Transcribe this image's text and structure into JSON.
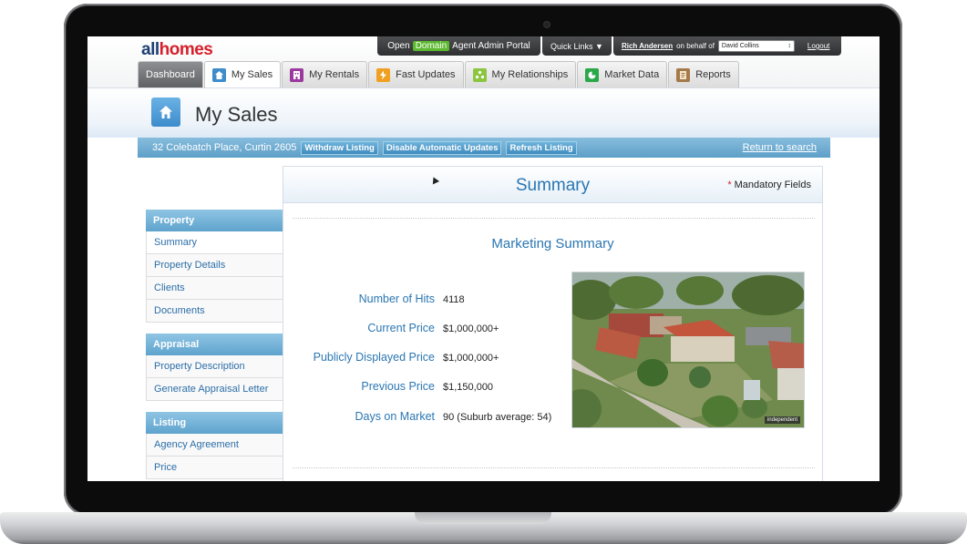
{
  "logo": {
    "part1": "all",
    "part2": "homes"
  },
  "portal_bar": {
    "open_label": "Open",
    "domain_label": "Domain",
    "portal_label": "Agent Admin Portal",
    "quick_links": "Quick Links ▼",
    "user_name": "Rich Andersen",
    "behalf_text": "on behalf of",
    "behalf_select": "David Collins",
    "logout": "Logout"
  },
  "tabs": [
    {
      "label": "Dashboard",
      "icon": "none"
    },
    {
      "label": "My Sales",
      "icon": "house-icon",
      "color": "#3d8ccc"
    },
    {
      "label": "My Rentals",
      "icon": "building-icon",
      "color": "#9b3a9e"
    },
    {
      "label": "Fast Updates",
      "icon": "lightning-icon",
      "color": "#f0a020"
    },
    {
      "label": "My Relationships",
      "icon": "people-icon",
      "color": "#8cc63f"
    },
    {
      "label": "Market Data",
      "icon": "pie-chart-icon",
      "color": "#2aa84a"
    },
    {
      "label": "Reports",
      "icon": "report-icon",
      "color": "#a57a4a"
    }
  ],
  "page": {
    "title": "My Sales"
  },
  "address_bar": {
    "address": "32 Colebatch Place, Curtin 2605",
    "buttons": [
      "Withdraw Listing",
      "Disable Automatic Updates",
      "Refresh Listing"
    ],
    "return_link": "Return to search"
  },
  "sidebar": {
    "sections": [
      {
        "title": "Property",
        "items": [
          "Summary",
          "Property Details",
          "Clients",
          "Documents"
        ]
      },
      {
        "title": "Appraisal",
        "items": [
          "Property Description",
          "Generate Appraisal Letter"
        ]
      },
      {
        "title": "Listing",
        "items": [
          "Agency Agreement",
          "Price"
        ]
      }
    ]
  },
  "panel": {
    "title": "Summary",
    "mandatory": "Mandatory Fields",
    "section_title": "Marketing Summary",
    "stats": [
      {
        "label": "Number of Hits",
        "value": "4118"
      },
      {
        "label": "Current Price",
        "value": "$1,000,000+"
      },
      {
        "label": "Publicly Displayed Price",
        "value": "$1,000,000+"
      },
      {
        "label": "Previous Price",
        "value": "$1,150,000"
      },
      {
        "label": "Days on Market",
        "value": "90 (Suburb average: 54)"
      }
    ],
    "photo_badge": "independent"
  },
  "colors": {
    "accent_blue": "#2a76b2",
    "nav_blue": "#5ea3cd",
    "logo_navy": "#1e3f73",
    "logo_red": "#d6212c",
    "domain_green": "#5bb82f"
  }
}
